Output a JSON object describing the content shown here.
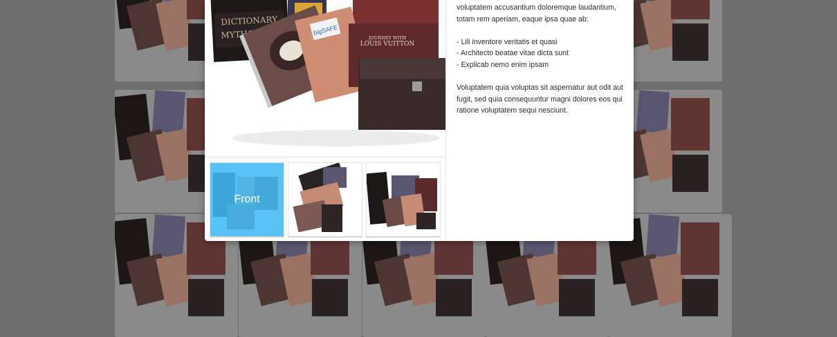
{
  "background": {
    "description_color": "#6e6e6e"
  },
  "modal": {
    "gallery": {
      "main_image": {
        "alt": "product-collage-main",
        "book_title_line1": "DICTIONARY",
        "book_title_line2": "MYTHOLOGY",
        "brochure_label_line1": "JOURNEY WITH",
        "brochure_label_line2": "LOUIS VUITTON",
        "label_text": "bigSAFE"
      },
      "thumbnails": [
        {
          "label": "Front",
          "active": true
        },
        {
          "label": "",
          "active": false
        },
        {
          "label": "",
          "active": false
        }
      ]
    },
    "description": {
      "intro": "voluptatem accusantium doloremque laudantium, totam rem aperiam, eaque ipsa quae ab:",
      "bullets": [
        "- Lili inventore veritatis et quasi",
        "- Architecto beatae vitae dicta sunt",
        "- Explicab nemo enim ipsam"
      ],
      "outro": "Voluptatem quia voluptas sit aspernatur aut odit aut fugit, sed quia consequuntur magni dolores eos qui ratione voluptatem sequi nesciunt."
    }
  },
  "colors": {
    "accent": "#42baf2",
    "overlay": "#6e6e6e",
    "text": "#2c2c2c"
  }
}
